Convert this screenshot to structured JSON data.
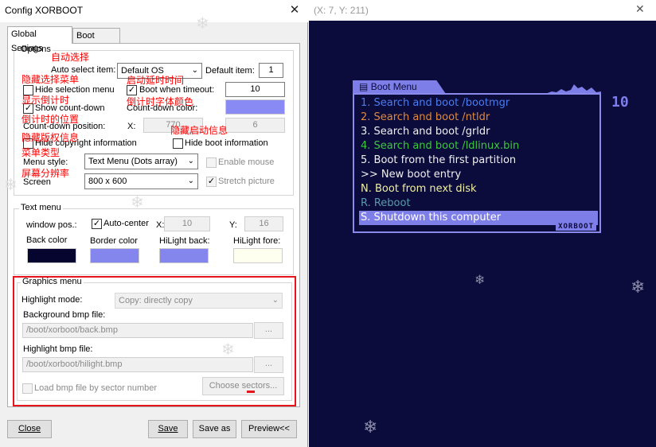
{
  "window": {
    "title": "Config XORBOOT",
    "close_glyph": "✕"
  },
  "tabs": [
    {
      "label": "Global Settings",
      "active": true
    },
    {
      "label": "Boot items",
      "active": false
    }
  ],
  "options": {
    "legend": "Options",
    "auto_select_label": "Auto select item:",
    "auto_select_value": "Default OS",
    "default_item_label": "Default item:",
    "default_item_value": "1",
    "hide_selection_label": "Hide selection menu",
    "hide_selection_checked": false,
    "boot_when_timeout_label": "Boot when timeout:",
    "boot_when_timeout_checked": true,
    "timeout_value": "10",
    "show_countdown_label": "Show count-down",
    "show_countdown_checked": true,
    "countdown_color_label": "Count-down color:",
    "countdown_color": "#8a8af5",
    "countdown_position_label": "Count-down position:",
    "x_label": "X:",
    "x_value": "770",
    "y_value": "6",
    "hide_copyright_label": "Hide copyright information",
    "hide_boot_info_label": "Hide boot information",
    "menu_style_label": "Menu style:",
    "menu_style_value": "Text Menu (Dots array)",
    "enable_mouse_label": "Enable mouse",
    "screen_label": "Screen",
    "screen_value": "800 x 600",
    "stretch_picture_label": "Stretch picture"
  },
  "annotations": {
    "auto_select": "自动选择",
    "hide_menu": "隐藏选择菜单",
    "boot_delay": "启动延时时间",
    "show_countdown": "显示倒计时",
    "countdown_font_color": "倒计时字体颜色",
    "countdown_position": "倒计时的位置",
    "hide_boot_info": "隐藏启动信息",
    "hide_copyright": "隐藏版权信息",
    "menu_type": "菜单类型",
    "screen_resolution": "屏幕分辨率"
  },
  "text_menu": {
    "legend": "Text menu",
    "window_pos_label": "window pos.:",
    "auto_center_label": "Auto-center",
    "auto_center_checked": true,
    "x_label": "X:",
    "x_value": "10",
    "y_label": "Y:",
    "y_value": "16",
    "back_color_label": "Back color",
    "back_color": "#050530",
    "border_color_label": "Border color",
    "border_color": "#8585ee",
    "hilight_back_label": "HiLight back:",
    "hilight_back_color": "#8585ee",
    "hilight_fore_label": "HiLight fore:",
    "hilight_fore_color": "#fffff0"
  },
  "graphics_menu": {
    "legend": "Graphics menu",
    "highlight_mode_label": "Highlight mode:",
    "highlight_mode_value": "Copy: directly copy",
    "background_bmp_label": "Background bmp file:",
    "background_bmp_value": "/boot/xorboot/back.bmp",
    "highlight_bmp_label": "Highlight bmp file:",
    "highlight_bmp_value": "/boot/xorboot/hilight.bmp",
    "browse_label": "...",
    "load_by_sector_label": "Load bmp file by sector number",
    "choose_sectors_label": "Choose sectors..."
  },
  "footer": {
    "close_label": "Close",
    "save_label": "Save",
    "save_as_label": "Save as",
    "preview_label": "Preview<<"
  },
  "preview": {
    "coords": "(X: 7, Y: 211)",
    "close_glyph": "✕",
    "menu_title": "Boot Menu",
    "countdown": "10",
    "brand": "XORBOOT",
    "items": [
      {
        "text": "1. Search and boot /bootmgr",
        "color": "#4a7cf0",
        "selected": false
      },
      {
        "text": "2. Search and boot /ntldr",
        "color": "#e08a3a",
        "selected": false
      },
      {
        "text": "3. Search and boot /grldr",
        "color": "#f0f0f0",
        "selected": false
      },
      {
        "text": "4. Search and boot /ldlinux.bin",
        "color": "#3cc83c",
        "selected": false
      },
      {
        "text": "5. Boot from the first partition",
        "color": "#f0f0f0",
        "selected": false
      },
      {
        "text": ">> New boot entry",
        "color": "#f0f0f0",
        "selected": false
      },
      {
        "text": "N. Boot from next disk",
        "color": "#f0f0a0",
        "selected": false
      },
      {
        "text": "R. Reboot",
        "color": "#5a9aaa",
        "selected": false
      },
      {
        "text": "S. Shutdown this computer",
        "color": "#ffffff",
        "selected": true
      }
    ],
    "colors": {
      "background": "#0b0b3c",
      "accent": "#7e7ee8"
    }
  }
}
